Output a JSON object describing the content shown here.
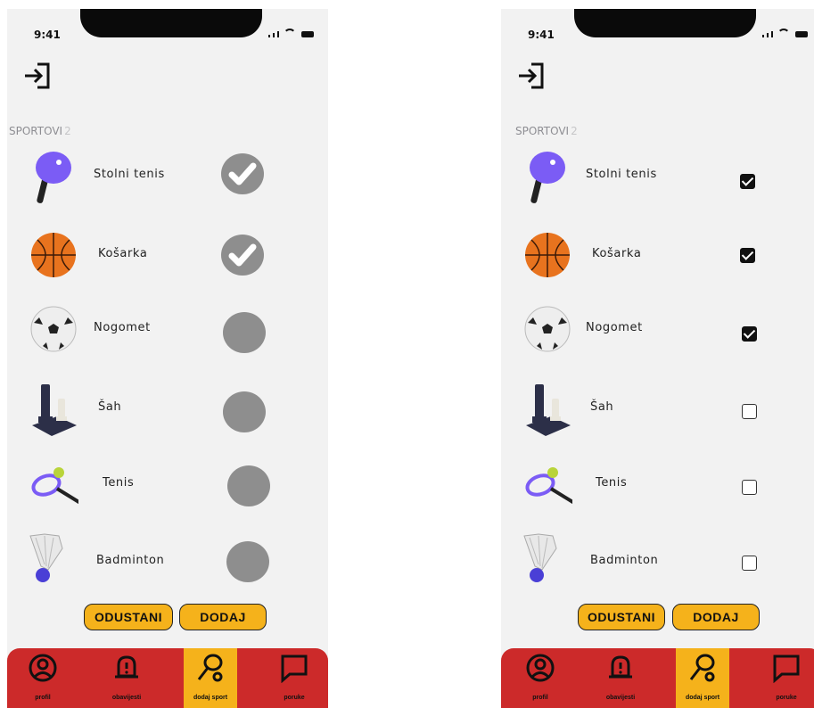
{
  "status_bar": {
    "time": "9:41"
  },
  "header": {
    "login_icon": "login-arrow-icon"
  },
  "section": {
    "title": "SPORTOVI",
    "count": "2"
  },
  "sports": [
    {
      "label": "Stolni tenis",
      "icon": "ping-pong-paddle-icon",
      "left_checked": true,
      "right_checked": true
    },
    {
      "label": "Košarka",
      "icon": "basketball-icon",
      "left_checked": true,
      "right_checked": true
    },
    {
      "label": "Nogomet",
      "icon": "soccer-ball-icon",
      "left_checked": false,
      "right_checked": true
    },
    {
      "label": "Šah",
      "icon": "chess-icon",
      "left_checked": false,
      "right_checked": false
    },
    {
      "label": "Tenis",
      "icon": "tennis-racket-icon",
      "left_checked": false,
      "right_checked": false
    },
    {
      "label": "Badminton",
      "icon": "shuttlecock-icon",
      "left_checked": false,
      "right_checked": false
    }
  ],
  "buttons": {
    "cancel": "ODUSTANI",
    "add": "DODAJ"
  },
  "tabs": [
    {
      "label": "profil",
      "icon": "profile-icon",
      "active": false
    },
    {
      "label": "obavijesti",
      "icon": "bell-icon",
      "active": false
    },
    {
      "label": "dodaj sport",
      "icon": "add-sport-icon",
      "active": true
    },
    {
      "label": "poruke",
      "icon": "message-icon",
      "active": false
    }
  ],
  "colors": {
    "tabbar": "#cc2a2a",
    "accent": "#f5b21b",
    "background": "#f2f2f2",
    "blob": "#8e8e8e"
  }
}
